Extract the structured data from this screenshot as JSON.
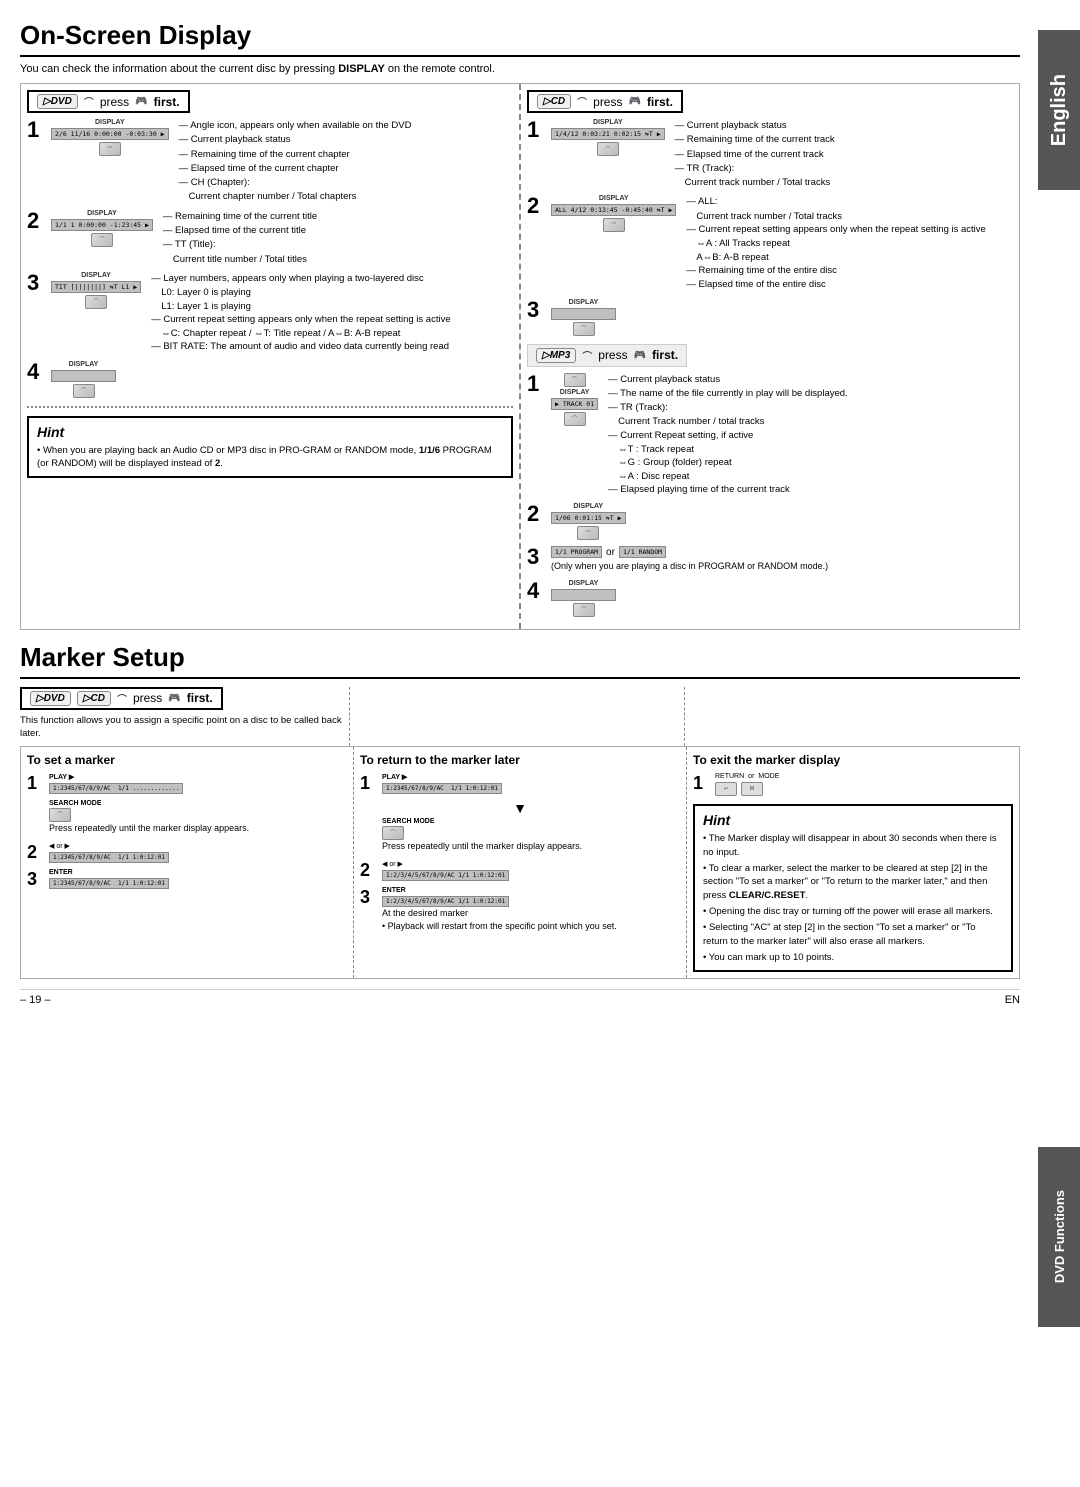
{
  "page": {
    "title_osd": "On-Screen Display",
    "title_marker": "Marker Setup",
    "intro_text": "You can check the information about the current disc by pressing",
    "intro_bold": "DISPLAY",
    "intro_suffix": "on the remote control.",
    "footer_page": "– 19 –",
    "footer_lang": "EN"
  },
  "tabs": {
    "english": "English",
    "dvd_functions": "DVD Functions"
  },
  "dvd_section": {
    "press_first_label": "press",
    "press_first_suffix": "first.",
    "disc_label": "DVD",
    "steps": [
      {
        "num": "1",
        "screen_label": "DISPLAY",
        "screen_text": "2/6  11/16  0:00:00  -0:03:30",
        "notes": [
          "Angle icon, appears only when available on the DVD",
          "Current playback status",
          "Remaining time of the current chapter",
          "Elapsed time of the current chapter",
          "CH (Chapter):",
          "Current chapter number / Total chapters"
        ]
      },
      {
        "num": "2",
        "screen_label": "DISPLAY",
        "screen_text": "1/1  1  0:00:00 -1:23:45",
        "notes": [
          "Remaining time of the current title",
          "Elapsed time of the current title",
          "TT (Title):",
          "Current title number / Total titles"
        ]
      },
      {
        "num": "3",
        "screen_label": "DISPLAY",
        "screen_text": "TIT  [|||||||]  T  L1",
        "notes": [
          "Layer numbers, appears only when playing a two-layered disc",
          "L0: Layer 0 is playing",
          "L1: Layer 1 is playing",
          "Current repeat setting appears only when the repeat setting is active",
          "⇔C: Chapter repeat / ⇔T: Title repeat / A⇔B: A-B repeat",
          "BIT RATE: The amount of audio and video data currently being read"
        ]
      },
      {
        "num": "4",
        "screen_label": "DISPLAY",
        "screen_text": ""
      }
    ]
  },
  "cd_section": {
    "press_first_label": "press",
    "press_first_suffix": "first.",
    "disc_label": "CD",
    "steps": [
      {
        "num": "1",
        "screen_label": "DISPLAY",
        "screen_text": "1/4/12  0:03:21  0:02:15  T",
        "notes": [
          "Current playback status",
          "Remaining time of the current track",
          "Elapsed time of the current track",
          "TR (Track):",
          "Current track number / Total tracks"
        ]
      },
      {
        "num": "2",
        "screen_label": "DISPLAY",
        "screen_text": "ALL 4/12  0:13:45 -0:45:40  T",
        "notes": [
          "ALL:",
          "Current track number / Total tracks",
          "Current repeat setting appears only when the repeat setting is active",
          "⇔A : All Tracks repeat",
          "A⇔B: A-B repeat",
          "Remaining time of the entire disc",
          "Elapsed time of the entire disc"
        ]
      },
      {
        "num": "3",
        "screen_label": "DISPLAY",
        "screen_text": ""
      }
    ]
  },
  "mp3_section": {
    "press_first_label": "press",
    "press_first_suffix": "first.",
    "disc_label": "MP3",
    "steps": [
      {
        "num": "1",
        "screen_label": "DISPLAY",
        "screen_text": "TRACK 01",
        "notes": [
          "Current playback status",
          "The name of the file currently in play will be displayed.",
          "TR (Track):",
          "Current Track number / total tracks",
          "Current Repeat setting, if active",
          "⇔T : Track repeat",
          "⇔G : Group (folder) repeat",
          "⇔A : Disc repeat",
          "Elapsed playing time of the current track"
        ]
      },
      {
        "num": "2",
        "screen_label": "DISPLAY",
        "screen_text": "1/06  0:01:15  T",
        "notes": []
      },
      {
        "num": "3",
        "screen_row_a": "1/1  PROGRAM",
        "screen_row_b": "1/1  RANDOM",
        "or_label": "or",
        "notes": [
          "(Only when you are playing a disc in PROGRAM or RANDOM mode.)"
        ]
      },
      {
        "num": "4",
        "screen_label": "DISPLAY",
        "screen_text": ""
      }
    ]
  },
  "hint_dvd": {
    "title": "Hint",
    "text": "When you are playing back an Audio CD or MP3 disc in PRO-GRAM or RANDOM mode,  PROGRAM (or RANDOM) will be displayed instead of  2 ."
  },
  "marker_setup": {
    "press_first_label": "press",
    "press_first_suffix": "first.",
    "disc_labels": [
      "DVD",
      "CD"
    ],
    "description": "This function allows you to assign a specific point on a disc to be called back later.",
    "col1_title": "To set a marker",
    "col2_title": "To return to the marker later",
    "col3_title": "To exit the marker display",
    "col1_steps": [
      {
        "num": "1",
        "icon": "PLAY",
        "screen": "1:2345/67/8/9/AC  1/1  .............",
        "note": ""
      },
      {
        "num": "",
        "icon": "SEARCH MODE",
        "note": "Press repeatedly until the marker display appears."
      },
      {
        "num": "2",
        "icon": "◄ or ►",
        "screen": "1:2345/67/8/9/AC  1/1  1:0:12:01",
        "note": ""
      },
      {
        "num": "3",
        "icon": "ENTER",
        "screen": "1:2345/67/8/9/AC  1/1  1:0:12:01",
        "note": ""
      }
    ],
    "col2_steps": [
      {
        "num": "1",
        "icon": "PLAY",
        "screen": "1:2345/67/8/9/AC  1/1  1:0:12:01",
        "note": ""
      },
      {
        "num": "",
        "icon": "SEARCH MODE",
        "note": "Press repeatedly until the marker display appears."
      },
      {
        "num": "2",
        "icon": "◄ or ►",
        "screen": "1:2/3/4/5/67/8/9/AC  1/1  1:0:12:01",
        "note": ""
      },
      {
        "num": "3",
        "icon": "ENTER",
        "screen": "1:2/3/4/5/67/8/9/AC  1/1  1:0:12:01",
        "note": "At the desired marker",
        "sub": "Playback will restart from the specific point which you set."
      }
    ],
    "col3_steps": [
      {
        "num": "1",
        "note": "RETURN or MODE"
      }
    ],
    "hint2": {
      "title": "Hint",
      "bullets": [
        "The Marker display will disappear in about 30 seconds when there is no input.",
        "To clear a marker, select the marker to be cleared at step [2] in the section \"To set a marker\" or \"To return to the marker later,\" and then press CLEAR/C.RESET.",
        "Opening the disc tray or turning off the power will erase all markers.",
        "Selecting \"AC\" at step [2] in the section \"To set a marker\" or \"To return to the marker later\" will also erase all markers.",
        "You can mark up to 10 points."
      ]
    }
  }
}
